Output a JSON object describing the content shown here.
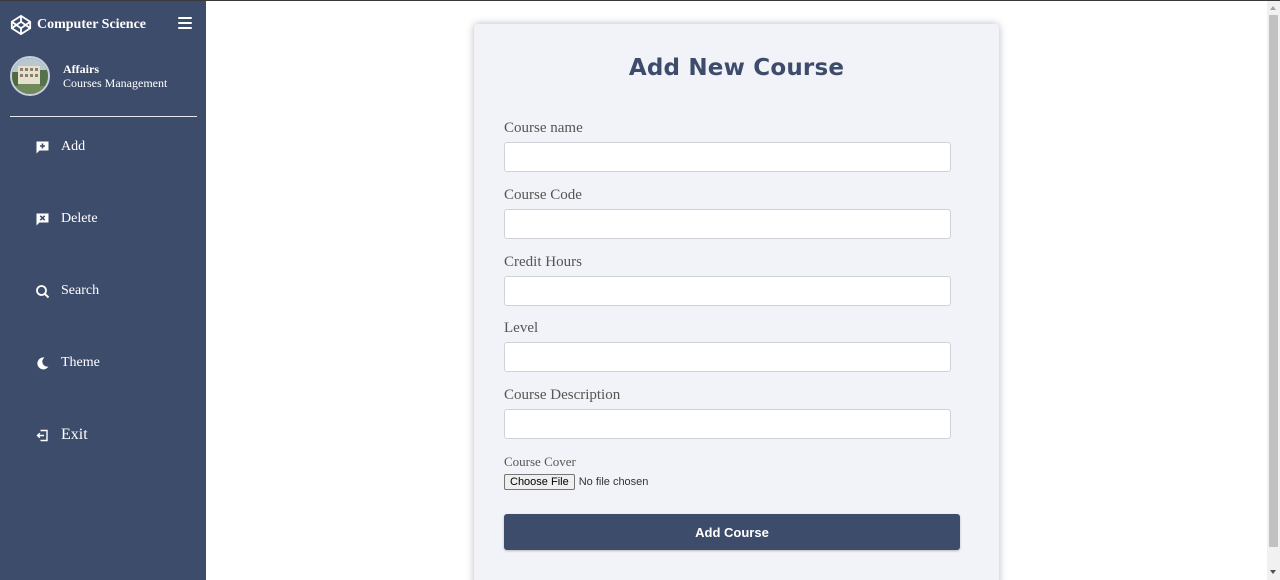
{
  "sidebar": {
    "brand": {
      "title": "Computer Science",
      "logo_icon": "codepen-logo-icon"
    },
    "menu_icon": "hamburger-menu-icon",
    "profile": {
      "name": "Affairs",
      "role": "Courses Management"
    },
    "nav": [
      {
        "label": "Add",
        "icon": "add-comment-icon"
      },
      {
        "label": "Delete",
        "icon": "delete-comment-icon"
      },
      {
        "label": "Search",
        "icon": "search-icon"
      },
      {
        "label": "Theme",
        "icon": "moon-icon"
      },
      {
        "label": "Exit",
        "icon": "logout-icon"
      }
    ]
  },
  "form": {
    "title": "Add New Course",
    "fields": [
      {
        "label": "Course name",
        "value": ""
      },
      {
        "label": "Course Code",
        "value": ""
      },
      {
        "label": "Credit Hours",
        "value": ""
      },
      {
        "label": "Level",
        "value": ""
      },
      {
        "label": "Course Description",
        "value": ""
      }
    ],
    "cover": {
      "label": "Course Cover",
      "button": "Choose File",
      "status": "No file chosen"
    },
    "submit_label": "Add Course"
  },
  "colors": {
    "sidebar_bg": "#3e4c6b",
    "accent": "#3e4c6b",
    "card_bg": "#f2f3f8",
    "page_bg": "#ffffff"
  }
}
